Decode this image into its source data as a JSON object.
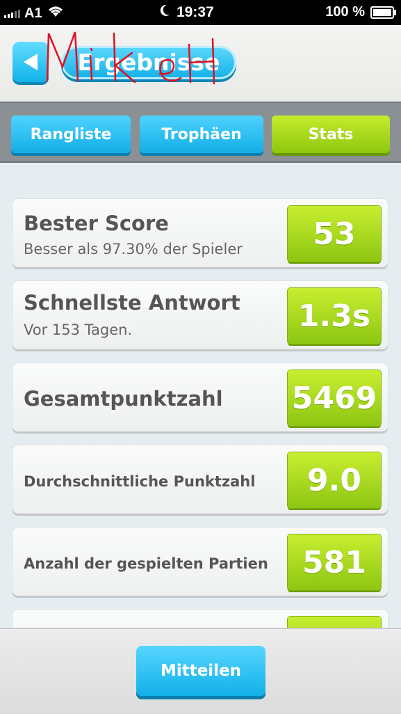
{
  "status_bar": {
    "carrier": "A1",
    "time": "19:37",
    "battery": "100 %"
  },
  "header": {
    "title": "Ergebnisse"
  },
  "tabs": [
    {
      "label": "Rangliste",
      "active": false
    },
    {
      "label": "Trophäen",
      "active": false
    },
    {
      "label": "Stats",
      "active": true
    }
  ],
  "stats": [
    {
      "label": "Bester Score",
      "sub": "Besser als 97.30% der Spieler",
      "value": "53"
    },
    {
      "label": "Schnellste Antwort",
      "sub": "Vor 153 Tagen.",
      "value": "1.3s"
    },
    {
      "label": "Gesamtpunktzahl",
      "sub": "",
      "value": "5469"
    },
    {
      "label": "Durchschnittliche Punktzahl",
      "sub": "",
      "value": "9.0"
    },
    {
      "label": "Anzahl der gespielten Partien",
      "sub": "",
      "value": "581"
    }
  ],
  "footer": {
    "share_label": "Mitteilen"
  },
  "colors": {
    "accent_blue": "#13b0e6",
    "accent_green": "#8dc612",
    "handwriting_red": "#e01020"
  }
}
